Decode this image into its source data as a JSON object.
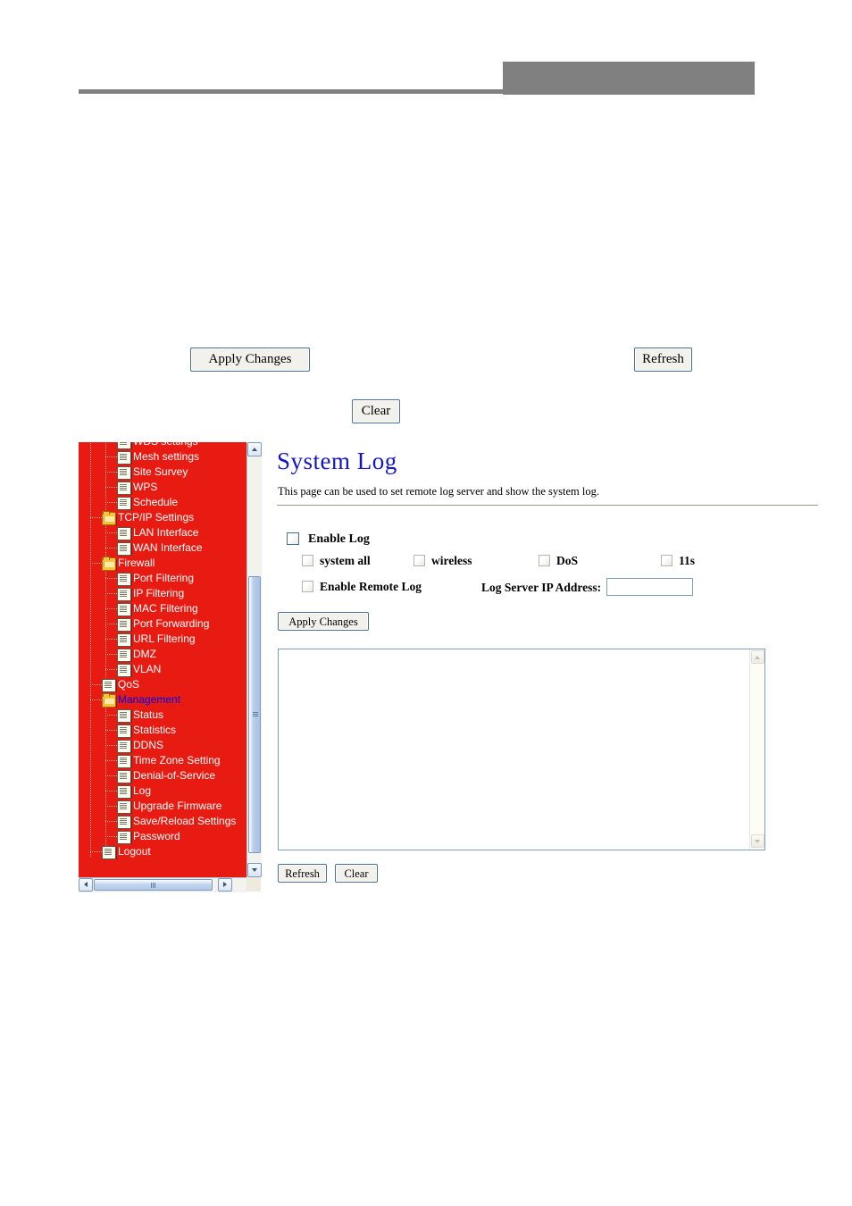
{
  "header": {
    "gray_block_color": "#808080",
    "rule_color": "#808080"
  },
  "doc_buttons": {
    "apply_changes": "Apply Changes",
    "refresh": "Refresh",
    "clear": "Clear"
  },
  "sidebar": {
    "background_color": "#e81b12",
    "active_item_color": "#0000ee",
    "items": [
      {
        "label": "WDS settings",
        "icon": "page-icon",
        "level": 2,
        "active": false
      },
      {
        "label": "Mesh settings",
        "icon": "page-icon",
        "level": 2,
        "active": false
      },
      {
        "label": "Site Survey",
        "icon": "page-icon",
        "level": 2,
        "active": false
      },
      {
        "label": "WPS",
        "icon": "page-icon",
        "level": 2,
        "active": false
      },
      {
        "label": "Schedule",
        "icon": "page-icon",
        "level": 2,
        "active": false
      },
      {
        "label": "TCP/IP Settings",
        "icon": "folder-icon",
        "level": 1,
        "active": false
      },
      {
        "label": "LAN Interface",
        "icon": "page-icon",
        "level": 2,
        "active": false
      },
      {
        "label": "WAN Interface",
        "icon": "page-icon",
        "level": 2,
        "active": false
      },
      {
        "label": "Firewall",
        "icon": "folder-icon",
        "level": 1,
        "active": false
      },
      {
        "label": "Port Filtering",
        "icon": "page-icon",
        "level": 2,
        "active": false
      },
      {
        "label": "IP Filtering",
        "icon": "page-icon",
        "level": 2,
        "active": false
      },
      {
        "label": "MAC Filtering",
        "icon": "page-icon",
        "level": 2,
        "active": false
      },
      {
        "label": "Port Forwarding",
        "icon": "page-icon",
        "level": 2,
        "active": false
      },
      {
        "label": "URL Filtering",
        "icon": "page-icon",
        "level": 2,
        "active": false
      },
      {
        "label": "DMZ",
        "icon": "page-icon",
        "level": 2,
        "active": false
      },
      {
        "label": "VLAN",
        "icon": "page-icon",
        "level": 2,
        "active": false
      },
      {
        "label": "QoS",
        "icon": "page-icon",
        "level": 1,
        "active": false
      },
      {
        "label": "Management",
        "icon": "folder-icon",
        "level": 1,
        "active": true
      },
      {
        "label": "Status",
        "icon": "page-icon",
        "level": 2,
        "active": false
      },
      {
        "label": "Statistics",
        "icon": "page-icon",
        "level": 2,
        "active": false
      },
      {
        "label": "DDNS",
        "icon": "page-icon",
        "level": 2,
        "active": false
      },
      {
        "label": "Time Zone Setting",
        "icon": "page-icon",
        "level": 2,
        "active": false
      },
      {
        "label": "Denial-of-Service",
        "icon": "page-icon",
        "level": 2,
        "active": false
      },
      {
        "label": "Log",
        "icon": "page-icon",
        "level": 2,
        "active": false
      },
      {
        "label": "Upgrade Firmware",
        "icon": "page-icon",
        "level": 2,
        "active": false
      },
      {
        "label": "Save/Reload Settings",
        "icon": "page-icon",
        "level": 2,
        "active": false
      },
      {
        "label": "Password",
        "icon": "page-icon",
        "level": 2,
        "active": false
      },
      {
        "label": "Logout",
        "icon": "page-icon",
        "level": 1,
        "active": false
      }
    ]
  },
  "main": {
    "title": "System Log",
    "description": "This page can be used to set remote log server and show the system log.",
    "enable_log": {
      "label": "Enable Log",
      "checked": false
    },
    "flags": [
      {
        "label": "system all",
        "checked": false
      },
      {
        "label": "wireless",
        "checked": false
      },
      {
        "label": "DoS",
        "checked": false
      },
      {
        "label": "11s",
        "checked": false
      }
    ],
    "remote_log": {
      "label": "Enable Remote Log",
      "checked": false
    },
    "log_server_ip": {
      "label": "Log Server IP Address:",
      "value": "",
      "placeholder": ""
    },
    "apply_button": "Apply Changes",
    "log_output": {
      "value": "",
      "placeholder": ""
    },
    "refresh_button": "Refresh",
    "clear_button": "Clear"
  }
}
